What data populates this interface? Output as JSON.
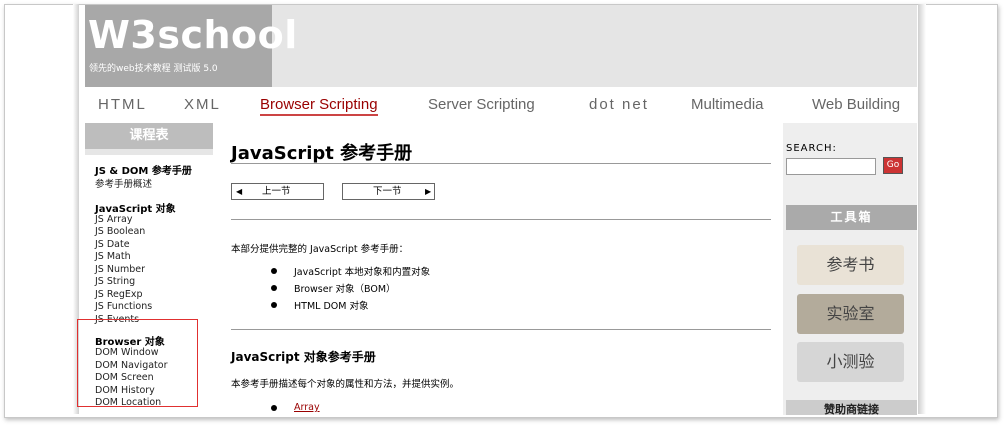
{
  "logo": {
    "title": "W3school",
    "subtitle": "领先的web技术教程 测试版 5.0"
  },
  "nav": {
    "items": [
      "HTML",
      "XML",
      "Browser Scripting",
      "Server Scripting",
      "dot net",
      "Multimedia",
      "Web Building"
    ],
    "active": "Browser Scripting"
  },
  "sidebar": {
    "header": "课程表",
    "groups": [
      {
        "title": "JS & DOM 参考手册",
        "links": [
          "参考手册概述"
        ]
      },
      {
        "title": "JavaScript 对象",
        "links": [
          "JS Array",
          "JS Boolean",
          "JS Date",
          "JS Math",
          "JS Number",
          "JS String",
          "JS RegExp",
          "JS Functions",
          "JS Events"
        ]
      },
      {
        "title": "Browser 对象",
        "links": [
          "DOM Window",
          "DOM Navigator",
          "DOM Screen",
          "DOM History",
          "DOM Location"
        ]
      }
    ]
  },
  "main": {
    "title": "JavaScript 参考手册",
    "prev_label": "上一节",
    "next_label": "下一节",
    "intro": "本部分提供完整的 JavaScript 参考手册：",
    "bullets": [
      "JavaScript 本地对象和内置对象",
      "Browser 对象（BOM）",
      "HTML DOM 对象"
    ],
    "section_title": "JavaScript 对象参考手册",
    "section_desc": "本参考手册描述每个对象的属性和方法，并提供实例。",
    "first_link": "Array"
  },
  "right": {
    "search_label": "SEARCH:",
    "search_go": "Go",
    "tools_header": "工具箱",
    "tools": [
      "参考书",
      "实验室",
      "小测验"
    ],
    "sponsor_header": "赞助商链接"
  },
  "colors": {
    "header_bg": "#e5e5e5",
    "logo_bg": "#a8a8a8",
    "active_link": "#990000",
    "highlight_border": "#e03030",
    "tool_1": "#e9e2d6",
    "tool_2": "#b3ab9b",
    "tool_3": "#d6d6d6"
  }
}
